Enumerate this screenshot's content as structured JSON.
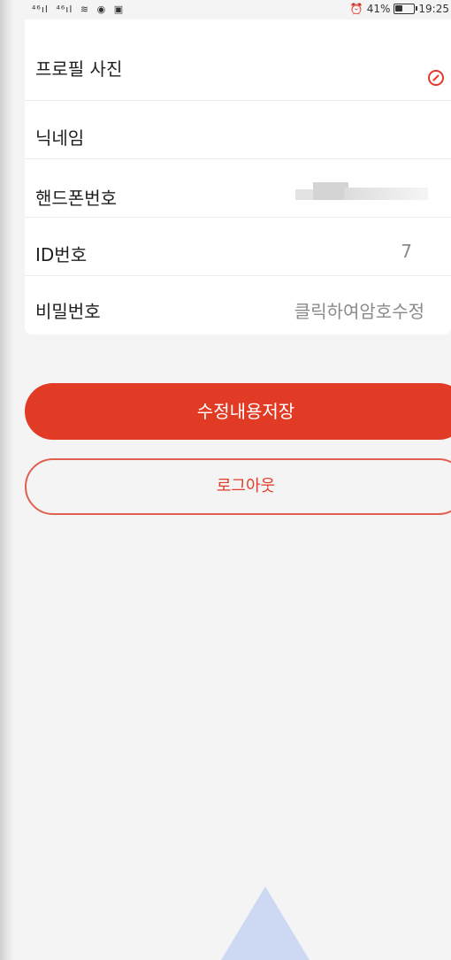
{
  "status_bar": {
    "left_icons": [
      "4G signal",
      "4G signal",
      "wifi",
      "eye",
      "notification"
    ],
    "alarm": "⏰",
    "battery": "41%",
    "battery_level": 0.41,
    "time": "19:25"
  },
  "profile": {
    "rows": [
      {
        "label": "프로필 사진",
        "value": ""
      },
      {
        "label": "닉네임",
        "value": ""
      },
      {
        "label": "핸드폰번호",
        "value": ""
      },
      {
        "label": "ID번호",
        "value": "7"
      },
      {
        "label": "비밀번호",
        "value": "클릭하여암호수정"
      }
    ],
    "edit_icon": "edit-pencil-icon"
  },
  "actions": {
    "save_label": "수정내용저장",
    "logout_label": "로그아웃"
  },
  "colors": {
    "accent": "#e23b25",
    "background": "#f4f4f4",
    "card": "#ffffff"
  }
}
